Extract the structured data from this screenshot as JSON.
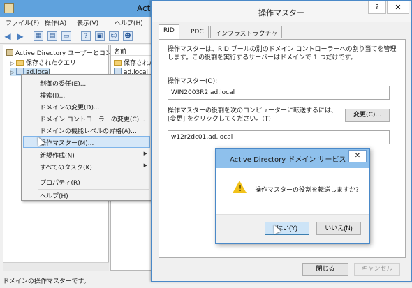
{
  "mmc": {
    "title": "Active",
    "menus": [
      "ファイル(F)",
      "操作(A)",
      "表示(V)",
      "ヘルプ(H)"
    ],
    "tree": {
      "root": "Active Directory ユーザーとコン",
      "saved_queries": "保存されたクエリ",
      "domain": "ad.local"
    },
    "list": {
      "column_name": "名前",
      "items": [
        "保存された",
        "ad.local"
      ]
    },
    "status": "ドメインの操作マスターです。"
  },
  "context_menu": {
    "items": [
      {
        "label": "制御の委任(E)..."
      },
      {
        "label": "検索(I)..."
      },
      {
        "label": "ドメインの変更(D)..."
      },
      {
        "label": "ドメイン コントローラーの変更(C)..."
      },
      {
        "label": "ドメインの機能レベルの昇格(A)..."
      },
      {
        "label": "操作マスター(M)...",
        "highlighted": true
      },
      {
        "label": "新規作成(N)",
        "submenu": true
      },
      {
        "label": "すべてのタスク(K)",
        "submenu": true
      },
      {
        "label": "プロパティ(R)"
      },
      {
        "label": "ヘルプ(H)"
      }
    ]
  },
  "ops_dialog": {
    "title": "操作マスター",
    "help_glyph": "?",
    "close_glyph": "✕",
    "tabs": [
      "RID",
      "PDC",
      "インフラストラクチャ"
    ],
    "active_tab": "RID",
    "description": "操作マスターは、RID プールの別のドメイン コントローラーへの割り当てを管理します。この役割を実行するサーバーはドメインで 1 つだけです。",
    "ops_master_label": "操作マスター(O):",
    "ops_master_value": "WIN2003R2.ad.local",
    "transfer_text": "操作マスターの役割を次のコンピューターに転送するには、[変更] をクリックしてください。(T)",
    "change_button": "変更(C)...",
    "target_value": "w12r2dc01.ad.local",
    "close_button": "閉じる",
    "cancel_button": "キャンセル"
  },
  "confirm_dialog": {
    "title": "Active Directory ドメイン サービス",
    "close_glyph": "✕",
    "message": "操作マスターの役割を転送しますか?",
    "yes_button": "はい(Y)",
    "no_button": "いいえ(N)"
  }
}
